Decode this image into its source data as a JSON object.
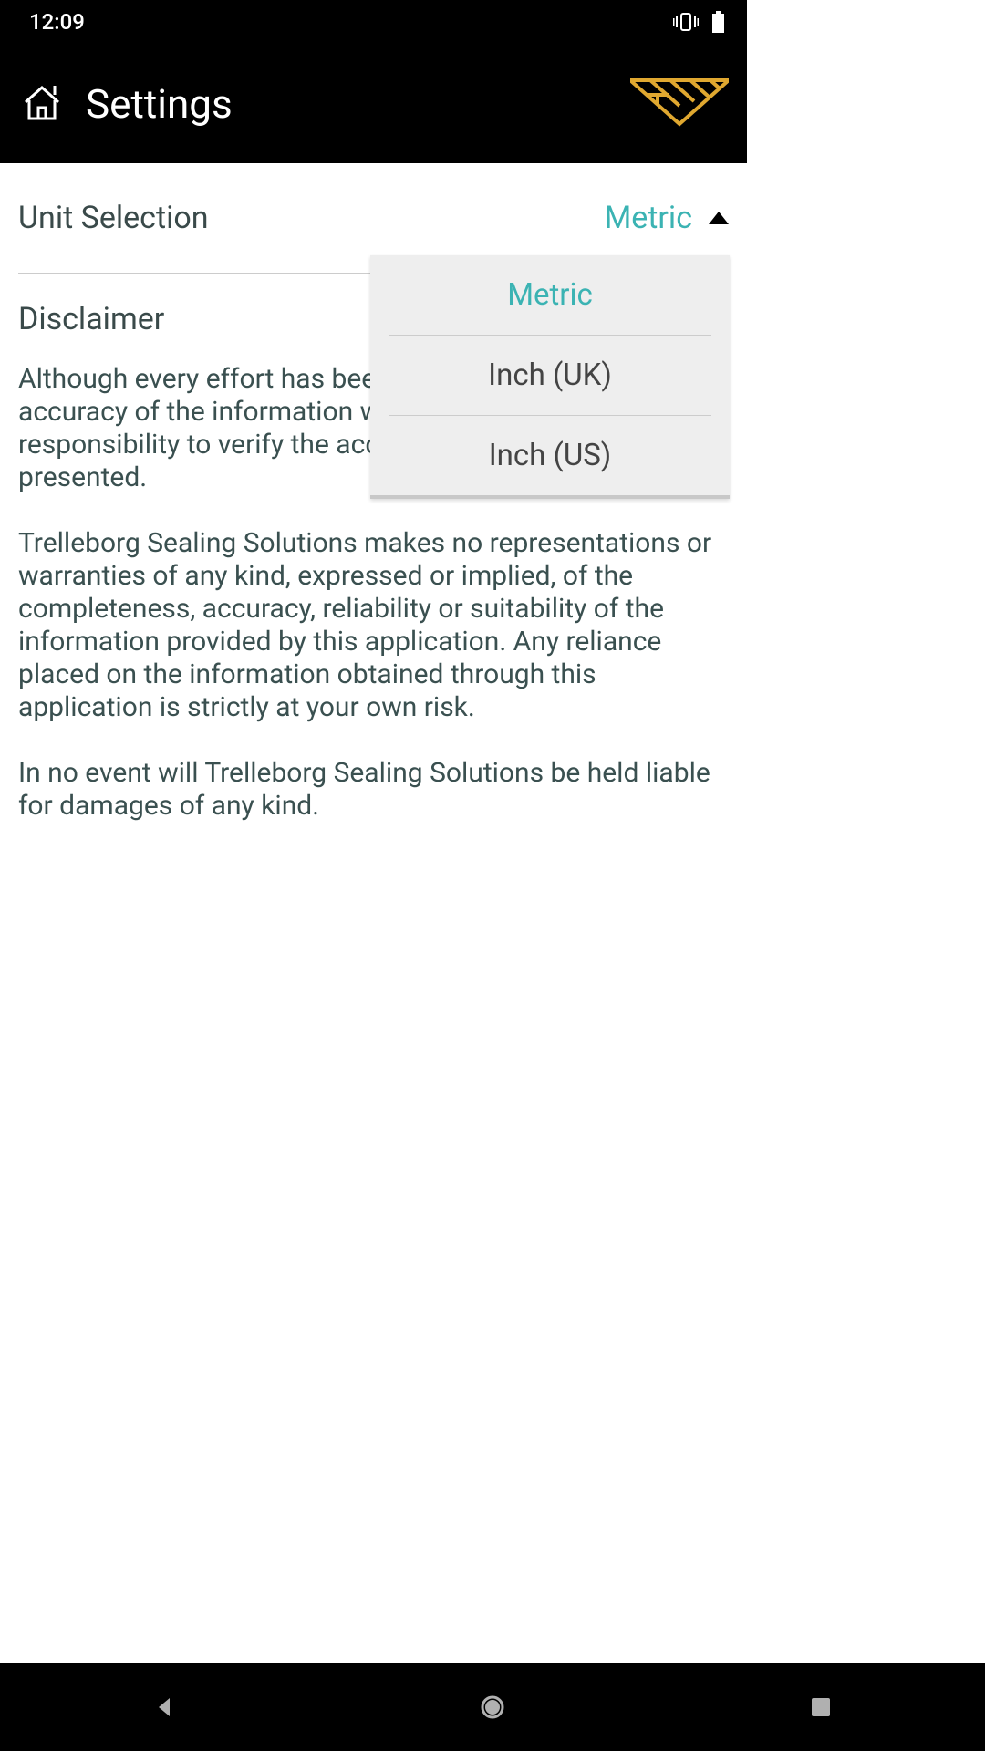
{
  "status_bar": {
    "time": "12:09"
  },
  "app_bar": {
    "title": "Settings"
  },
  "unit_selection": {
    "label": "Unit Selection",
    "selected": "Metric",
    "options": [
      "Metric",
      "Inch (UK)",
      "Inch (US)"
    ]
  },
  "disclaimer": {
    "title": "Disclaimer",
    "p1": "Although every effort has been made to assure the accuracy of the information within this app, it is your responsibility to verify the accuracy of any values presented.",
    "p2": "Trelleborg Sealing Solutions makes no representations or warranties of any kind, expressed or implied, of the completeness, accuracy, reliability or suitability of the information provided by this application. Any reliance placed on the information obtained through this application is strictly at your own risk.",
    "p3": "In no event will Trelleborg Sealing Solutions be held liable for damages of any kind."
  },
  "colors": {
    "accent": "#3bb3b3",
    "brand": "#e0a830"
  }
}
